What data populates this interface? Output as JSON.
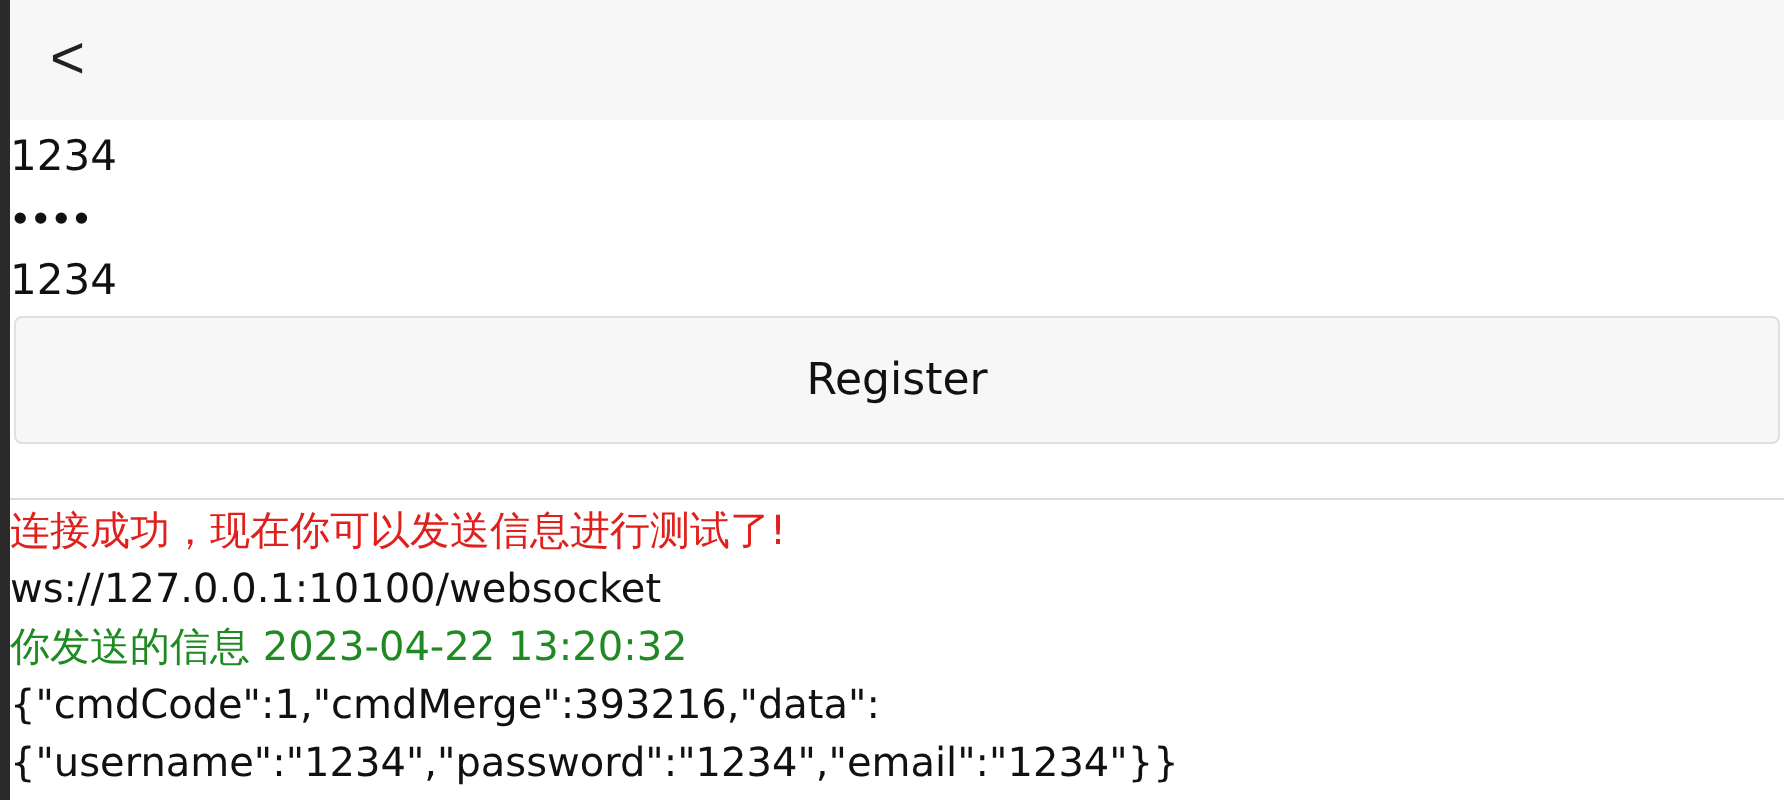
{
  "header": {
    "back": "<"
  },
  "fields": [
    {
      "kind": "text",
      "value": "1234"
    },
    {
      "kind": "password",
      "value": "••••"
    },
    {
      "kind": "text",
      "value": "1234"
    }
  ],
  "register_button": "Register",
  "log": [
    {
      "text": "连接成功，现在你可以发送信息进行测试了!",
      "color": "#e0201c"
    },
    {
      "text": "ws://127.0.0.1:10100/websocket",
      "color": "#111111"
    },
    {
      "text": "你发送的信息 2023-04-22 13:20:32",
      "color": "#1f8a22"
    },
    {
      "text": "{\"cmdCode\":1,\"cmdMerge\":393216,\"data\":",
      "color": "#111111"
    },
    {
      "text": "{\"username\":\"1234\",\"password\":\"1234\",\"email\":\"1234\"}}",
      "color": "#111111"
    }
  ]
}
